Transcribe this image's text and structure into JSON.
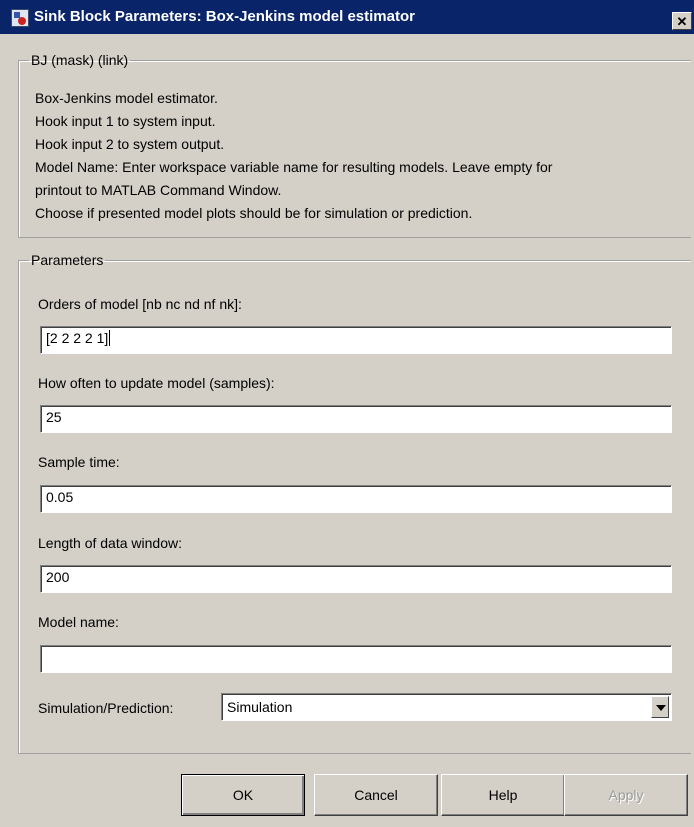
{
  "window": {
    "title": "Sink Block Parameters: Box-Jenkins model estimator",
    "close_label": "✕"
  },
  "description": {
    "legend": "BJ (mask) (link)",
    "lines": [
      "Box-Jenkins model estimator.",
      "Hook input 1 to system input.",
      "Hook input 2 to system output.",
      "Model Name: Enter workspace variable name for resulting models. Leave empty for",
      "printout to MATLAB Command Window.",
      "Choose if presented model plots should be for simulation or prediction."
    ]
  },
  "parameters": {
    "legend": "Parameters",
    "orders": {
      "label": "Orders of model [nb nc nd nf nk]:",
      "value": "[2 2 2 2 1]"
    },
    "update": {
      "label": "How often to update model (samples):",
      "value": "25"
    },
    "sample_time": {
      "label": "Sample time:",
      "value": "0.05"
    },
    "data_window": {
      "label": "Length of data window:",
      "value": "200"
    },
    "model_name": {
      "label": "Model name:",
      "value": ""
    },
    "sim_pred": {
      "label": "Simulation/Prediction:",
      "value": "Simulation"
    }
  },
  "buttons": {
    "ok": "OK",
    "cancel": "Cancel",
    "help": "Help",
    "apply": "Apply"
  }
}
